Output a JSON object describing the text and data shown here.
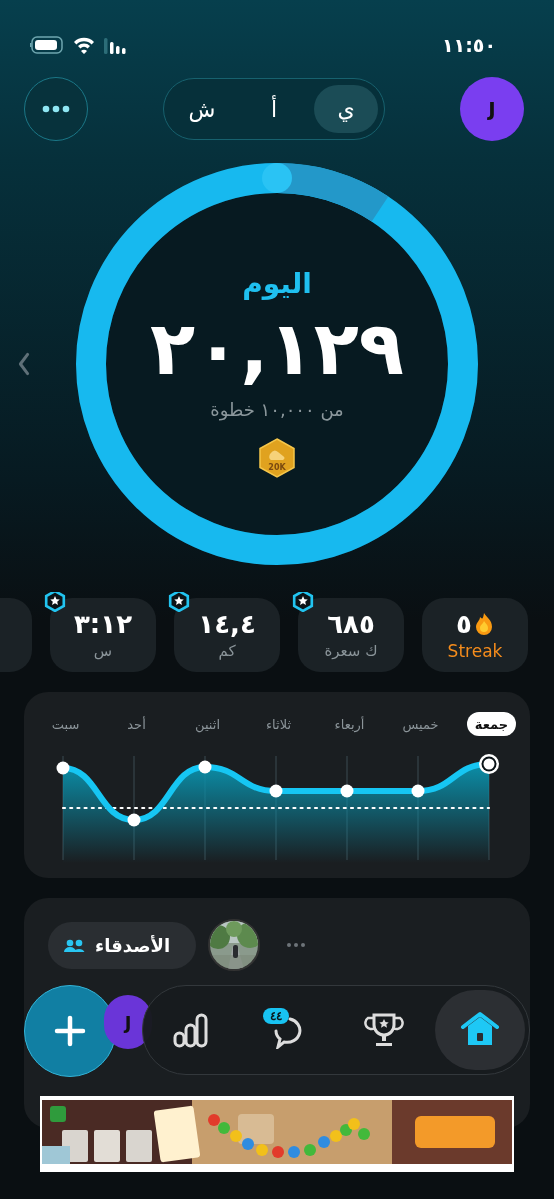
{
  "status_bar": {
    "time": "١١:٥٠"
  },
  "header": {
    "avatar": "J",
    "tabs": [
      {
        "label": "ي",
        "selected": true
      },
      {
        "label": "أ",
        "selected": false
      },
      {
        "label": "ش",
        "selected": false
      }
    ]
  },
  "progress": {
    "title": "اليوم",
    "steps": "٢٠,١٢٩",
    "goal": "من ١٠,٠٠٠ خطوة",
    "badge": "20K"
  },
  "stats": [
    {
      "kind": "streak",
      "value": "٥",
      "label": "Streak",
      "starred": false
    },
    {
      "kind": "metric",
      "value": "٦٨٥",
      "label": "ك سعرة",
      "starred": true
    },
    {
      "kind": "metric",
      "value": "١٤,٤",
      "label": "كم",
      "starred": true
    },
    {
      "kind": "metric",
      "value": "٣:١٢",
      "label": "س",
      "starred": true
    },
    {
      "kind": "partial",
      "starred": false
    }
  ],
  "week": {
    "days": [
      {
        "label": "جمعة",
        "selected": true
      },
      {
        "label": "خميس",
        "selected": false
      },
      {
        "label": "أربعاء",
        "selected": false
      },
      {
        "label": "ثلاثاء",
        "selected": false
      },
      {
        "label": "اثنين",
        "selected": false
      },
      {
        "label": "أحد",
        "selected": false
      },
      {
        "label": "سبت",
        "selected": false
      }
    ]
  },
  "friends": {
    "label": "الأصدقاء"
  },
  "bottom_nav": {
    "avatar": "J",
    "items": [
      {
        "kind": "home",
        "selected": true
      },
      {
        "kind": "trophy",
        "selected": false
      },
      {
        "kind": "chat",
        "selected": false,
        "badge": "٤٤"
      },
      {
        "kind": "stats",
        "selected": false
      }
    ]
  }
}
